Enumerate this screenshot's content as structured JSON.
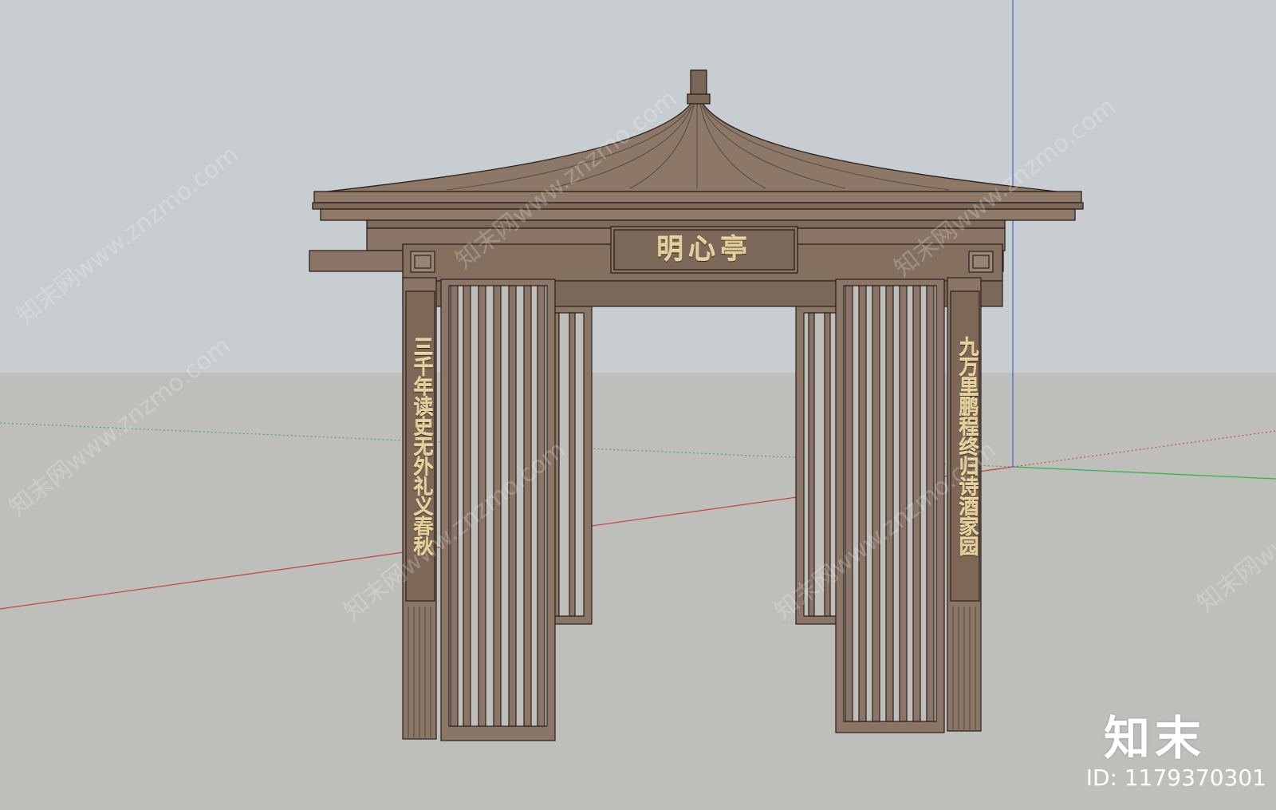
{
  "pavilion": {
    "name_plaque": "明心亭",
    "couplet_left": "三千年读史无外礼义春秋",
    "couplet_right": "九万里鹏程终归诗酒家园"
  },
  "watermark": {
    "text": "知末网www.znzmo.com"
  },
  "branding": {
    "logo": "知末",
    "image_id": "ID: 1179370301"
  },
  "colors": {
    "sky": "#c7ccd0",
    "ground": "#bdbdb9",
    "wood": "#8a7566",
    "wood_dark": "#6e5a4c",
    "gold_text": "#e4cf9a"
  }
}
